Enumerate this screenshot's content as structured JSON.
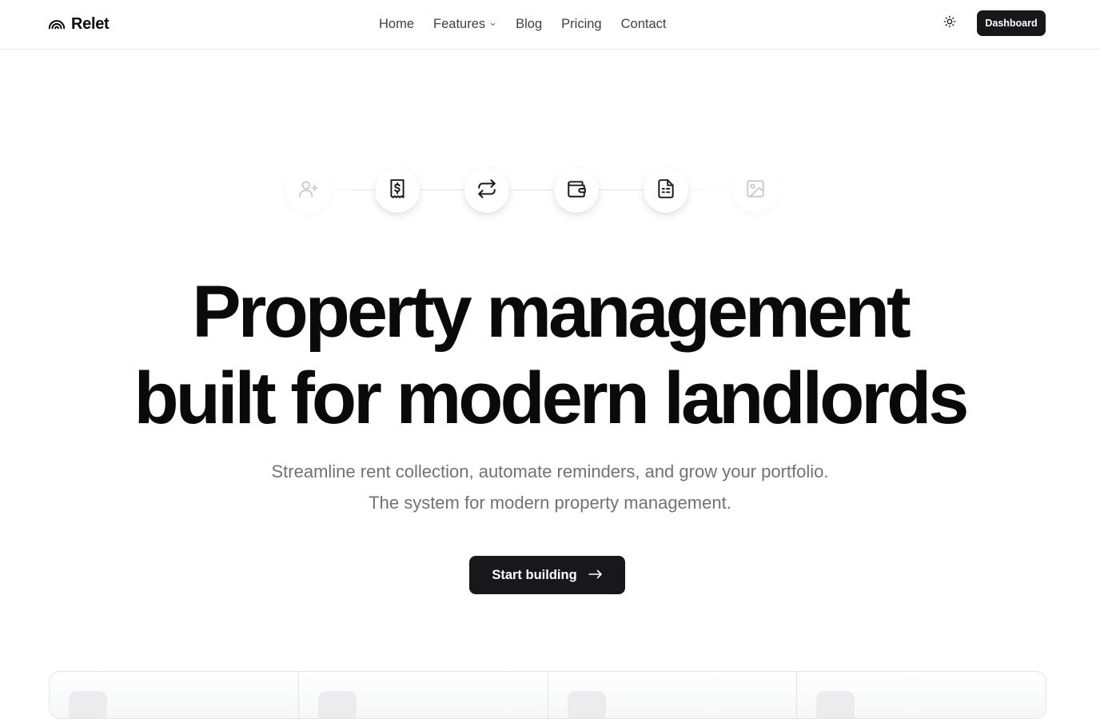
{
  "brand": {
    "name": "Relet",
    "logo_icon": "rainbow-arc-icon"
  },
  "nav": {
    "items": [
      {
        "label": "Home"
      },
      {
        "label": "Features",
        "has_dropdown": true
      },
      {
        "label": "Blog"
      },
      {
        "label": "Pricing"
      },
      {
        "label": "Contact"
      }
    ]
  },
  "header_actions": {
    "theme_icon": "sun-icon",
    "dashboard_label": "Dashboard"
  },
  "icon_chain": [
    {
      "icon": "user-plus-icon",
      "faded": true
    },
    {
      "icon": "receipt-dollar-icon",
      "faded": false
    },
    {
      "icon": "repeat-icon",
      "faded": false
    },
    {
      "icon": "wallet-icon",
      "faded": false
    },
    {
      "icon": "document-icon",
      "faded": false
    },
    {
      "icon": "image-icon",
      "faded": true
    }
  ],
  "hero": {
    "headline_line1": "Property management",
    "headline_line2": "built for modern landlords",
    "subtitle_line1": "Streamline rent collection, automate reminders, and grow your portfolio.",
    "subtitle_line2": "The system for modern property management.",
    "cta_label": "Start building",
    "cta_icon": "arrow-right-icon"
  },
  "colors": {
    "primary": "#18181b",
    "text": "#0a0a0a",
    "muted": "#71717a",
    "border": "#e4e4e7"
  }
}
